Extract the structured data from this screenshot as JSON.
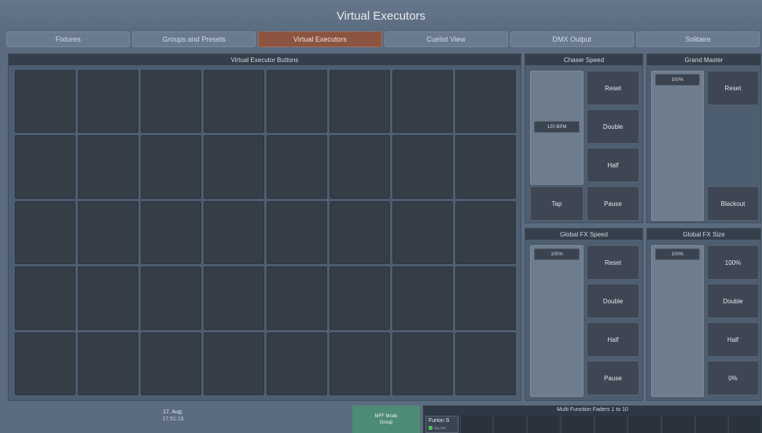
{
  "window": {
    "title": "Virtual Executors"
  },
  "tabs": [
    {
      "label": "Fixtures"
    },
    {
      "label": "Groups and Presets"
    },
    {
      "label": "Virtual Executors",
      "active": true
    },
    {
      "label": "Cuelist View"
    },
    {
      "label": "DMX Output"
    },
    {
      "label": "Solitaire"
    }
  ],
  "veb": {
    "title": "Virtual Executor Buttons",
    "rows": 5,
    "cols": 8
  },
  "chaser": {
    "title": "Chaser Speed",
    "value": "120 BPM",
    "reset": "Reset",
    "double": "Double",
    "half": "Half",
    "tap": "Tap",
    "pause": "Pause"
  },
  "grandmaster": {
    "title": "Grand Master",
    "value": "100%",
    "reset": "Reset",
    "blackout": "Blackout"
  },
  "fxspeed": {
    "title": "Global FX Speed",
    "value": "100%",
    "reset": "Reset",
    "double": "Double",
    "half": "Half",
    "pause": "Pause"
  },
  "fxsize": {
    "title": "Global FX Size",
    "value": "100%",
    "full": "100%",
    "double": "Double",
    "half": "Half",
    "zero": "0%"
  },
  "status": {
    "date": "17. Aug.",
    "time": "17:51:16",
    "mff_mode_label": "MFF Mode",
    "mff_mode_value": "Group"
  },
  "mff": {
    "title": "Multi Function Faders 1 to 10",
    "first_name": "Furion S",
    "first_sub": "Grp 100"
  },
  "colors": {
    "active_tab": "#8a5440",
    "mff_mode": "#4e8b74",
    "status_dot": "#4fc15d"
  }
}
